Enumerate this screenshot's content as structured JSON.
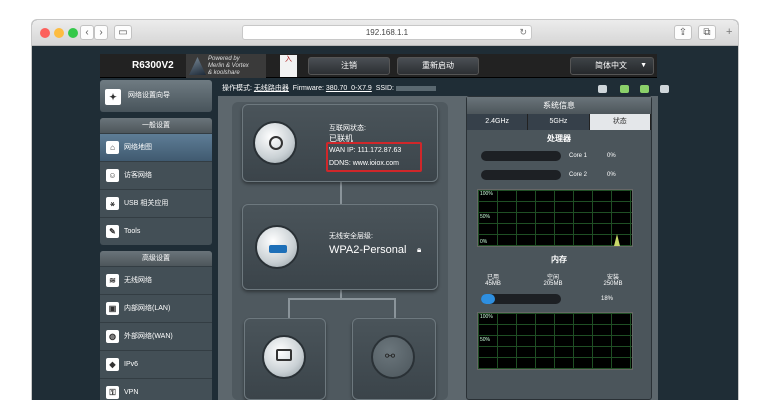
{
  "browser": {
    "url": "192.168.1.1"
  },
  "header": {
    "model": "R6300V2",
    "logo_line1": "Powered by",
    "logo_line2": "Merlin & Vortex",
    "logo_line3": "& koolshare",
    "stamp": "入",
    "logout": "注销",
    "reboot": "重新启动",
    "language": "简体中文"
  },
  "sidebar": {
    "wizard": "网络设置向导",
    "general_title": "一般设置",
    "general": [
      {
        "label": "网络地图"
      },
      {
        "label": "访客网络"
      },
      {
        "label": "USB 相关应用"
      },
      {
        "label": "Tools"
      }
    ],
    "advanced_title": "高级设置",
    "advanced": [
      {
        "label": "无线网络"
      },
      {
        "label": "内部网络(LAN)"
      },
      {
        "label": "外部网络(WAN)"
      },
      {
        "label": "IPv6"
      },
      {
        "label": "VPN"
      }
    ]
  },
  "status": {
    "mode_label": "操作模式:",
    "mode": "无线路由器",
    "fw_label": "Firmware:",
    "fw": "380.70_0-X7.9",
    "ssid_label": "SSID:"
  },
  "map": {
    "internet_label": "互联网状态:",
    "internet_status": "已联机",
    "wan_ip": "WAN IP: 111.172.87.63",
    "ddns": "DDNS: www.ioiox.com",
    "wifi_label": "无线安全层级:",
    "wifi_level": "WPA2-Personal"
  },
  "sysinfo": {
    "title": "系统信息",
    "tabs": [
      {
        "label": "2.4GHz"
      },
      {
        "label": "5GHz"
      },
      {
        "label": "状态"
      }
    ],
    "cpu_title": "处理器",
    "cores": [
      {
        "name": "Core 1",
        "pct": "0%"
      },
      {
        "name": "Core 2",
        "pct": "0%"
      }
    ],
    "graph_top": "100%",
    "graph_mid": "50%",
    "graph_bot": "0%",
    "mem_title": "内存",
    "mem_cols": [
      {
        "label": "已用",
        "value": "45MB"
      },
      {
        "label": "空闲",
        "value": "205MB"
      },
      {
        "label": "安装",
        "value": "250MB"
      }
    ],
    "mem_pct": "18%",
    "mem_fill": 0.18
  }
}
